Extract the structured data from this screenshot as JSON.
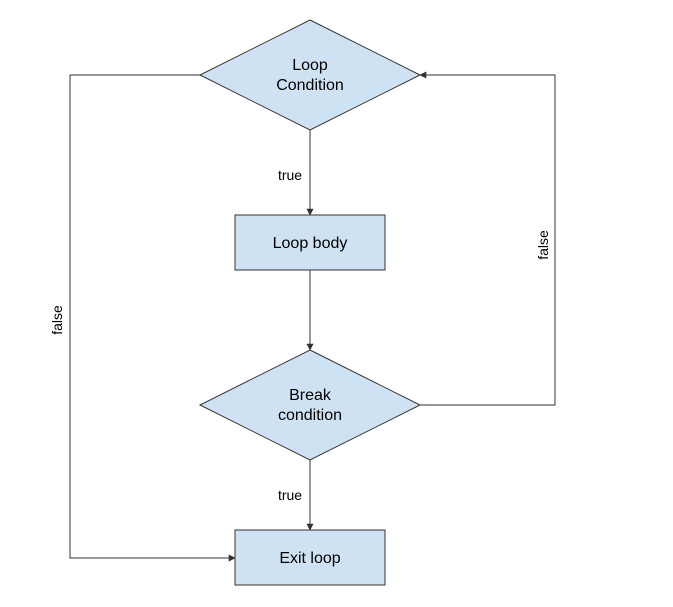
{
  "nodes": {
    "loop_condition": {
      "line1": "Loop",
      "line2": "Condition"
    },
    "loop_body": {
      "label": "Loop body"
    },
    "break_condition": {
      "line1": "Break",
      "line2": "condition"
    },
    "exit_loop": {
      "label": "Exit loop"
    }
  },
  "edges": {
    "cond_to_body": "true",
    "break_to_exit": "true",
    "cond_to_exit": "false",
    "break_to_cond": "false"
  }
}
